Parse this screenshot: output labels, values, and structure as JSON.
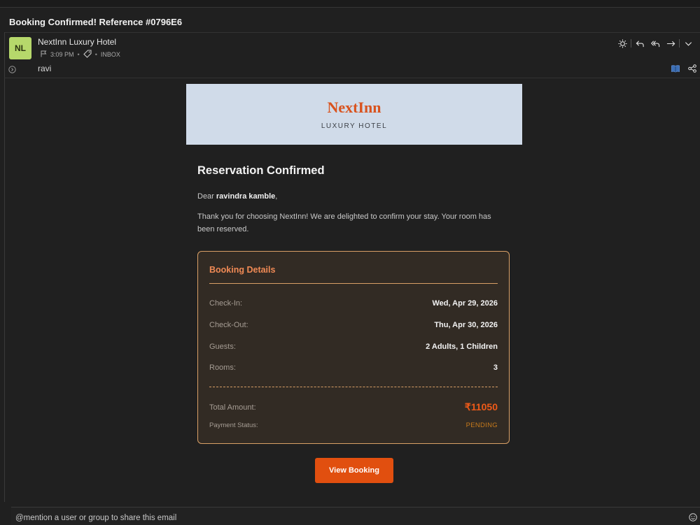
{
  "subject": "Booking Confirmed! Reference #0796E6",
  "sender": {
    "initials": "NL",
    "name": "NextInn Luxury Hotel",
    "time": "3:09 PM",
    "folder": "INBOX",
    "recipient": "ravi",
    "avatar_color": "#b6d86b"
  },
  "toolbar": {
    "icons": [
      "brightness-icon",
      "reply-icon",
      "reply-all-icon",
      "forward-icon",
      "chevron-down-icon"
    ]
  },
  "email": {
    "brand": "NextInn",
    "brand_sub": "LUXURY HOTEL",
    "heading": "Reservation Confirmed",
    "greeting_prefix": "Dear ",
    "guest_name": "ravindra kamble",
    "greeting_suffix": ",",
    "body": "Thank you for choosing NextInn! We are delighted to confirm your stay. Your room has been reserved.",
    "details_title": "Booking Details",
    "details": [
      {
        "label": "Check-In:",
        "value": "Wed, Apr 29, 2026"
      },
      {
        "label": "Check-Out:",
        "value": "Thu, Apr 30, 2026"
      },
      {
        "label": "Guests:",
        "value": "2 Adults, 1 Children"
      },
      {
        "label": "Rooms:",
        "value": "3"
      }
    ],
    "total_label": "Total Amount:",
    "total_value": "₹11050",
    "payment_label": "Payment Status:",
    "payment_value": "PENDING",
    "button_label": "View Booking",
    "accent_color": "#e14f0f"
  },
  "mention": {
    "placeholder": "@mention a user or group to share this email"
  }
}
